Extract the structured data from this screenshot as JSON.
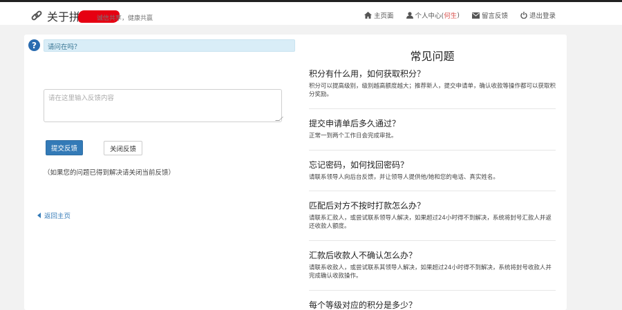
{
  "header": {
    "brand_name": "关于拼金",
    "slogan": "诚信共享，健康共赢",
    "nav": [
      {
        "icon": "home-icon",
        "label": "主页面"
      },
      {
        "icon": "user-icon",
        "label": "个人中心(",
        "user": "何生",
        "suffix": ")"
      },
      {
        "icon": "envelope-icon",
        "label": "留言反馈"
      },
      {
        "icon": "power-icon",
        "label": "退出登录"
      }
    ]
  },
  "left": {
    "question_bar": "请问在吗？",
    "feedback_placeholder": "请在这里输入反馈内容",
    "submit_label": "提交反馈",
    "close_label": "关闭反馈",
    "hint": "（如果您的问题已得到解决请关闭当前反馈）",
    "back_label": "返回主页"
  },
  "faq": {
    "title": "常见问题",
    "items": [
      {
        "q": "积分有什么用，如何获取积分？",
        "a": "积分可以提高级别，级别越高额度越大；推荐新人，提交申请单，确认收款等操作都可以获取积分奖励。"
      },
      {
        "q": "提交申请单后多久通过？",
        "a": "正常一到两个工作日会完成审批。"
      },
      {
        "q": "忘记密码，如何找回密码？",
        "a": "请联系领导人向后台反馈，并让领导人提供他/她和您的电话、真实姓名。"
      },
      {
        "q": "匹配后对方不按时打款怎么办？",
        "a": "请联系汇款人，或尝试联系领导人解决，如果超过24小时得不到解决，系统将封号汇款人并返还收款人额度。"
      },
      {
        "q": "汇款后收款人不确认怎么办？",
        "a": "请联系收款人，或尝试联系其领导人解决，如果超过24小时得不到解决，系统将封号收款人并完成确认收款操作。"
      },
      {
        "q": "每个等级对应的积分是多少？",
        "a": ""
      }
    ]
  },
  "colors": {
    "primary": "#337ab7",
    "alert_bg": "#d9edf7",
    "highlight": "#d9534f"
  }
}
